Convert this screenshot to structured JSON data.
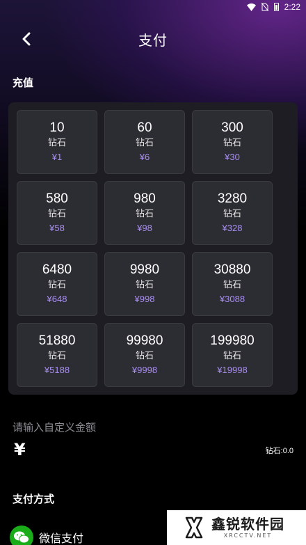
{
  "status_bar": {
    "time": "2:22"
  },
  "header": {
    "title": "支付"
  },
  "recharge": {
    "section_title": "充值",
    "unit": "钻石",
    "packages": [
      {
        "amount": "10",
        "price": "¥1"
      },
      {
        "amount": "60",
        "price": "¥6"
      },
      {
        "amount": "300",
        "price": "¥30"
      },
      {
        "amount": "580",
        "price": "¥58"
      },
      {
        "amount": "980",
        "price": "¥98"
      },
      {
        "amount": "3280",
        "price": "¥328"
      },
      {
        "amount": "6480",
        "price": "¥648"
      },
      {
        "amount": "9980",
        "price": "¥998"
      },
      {
        "amount": "30880",
        "price": "¥3088"
      },
      {
        "amount": "51880",
        "price": "¥5188"
      },
      {
        "amount": "99980",
        "price": "¥9998"
      },
      {
        "amount": "199980",
        "price": "¥19998"
      }
    ]
  },
  "custom_amount": {
    "label": "请输入自定义金额",
    "currency_symbol": "¥",
    "value": "",
    "diamond_readout": "钻石:0.0"
  },
  "payment": {
    "section_title": "支付方式",
    "methods": [
      {
        "label": "微信支付",
        "icon": "wechat-icon"
      }
    ]
  },
  "watermark": {
    "main": "鑫锐软件园",
    "sub": "XRCCTV.NET"
  },
  "colors": {
    "price": "#a98ff0",
    "card": "#2c2c33",
    "panel": "#1d1d23",
    "wechat": "#1aad19"
  }
}
